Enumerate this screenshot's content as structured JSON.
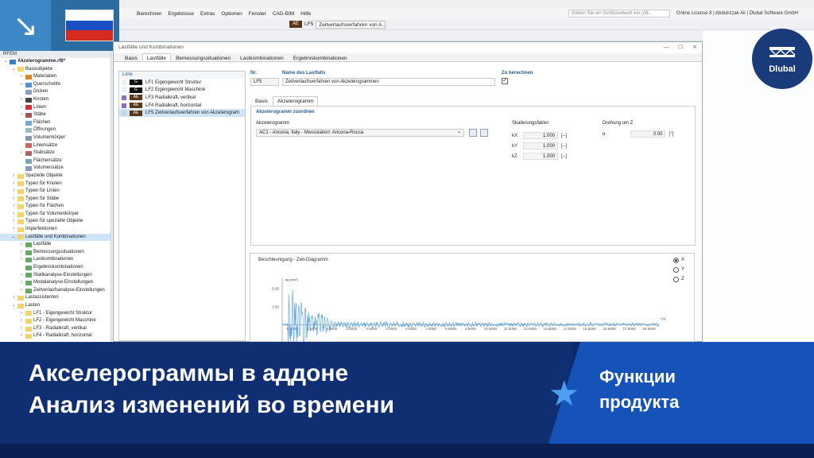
{
  "menu": {
    "items": [
      "Berechnen",
      "Ergebnisse",
      "Extras",
      "Optionen",
      "Fenster",
      "CAD-BIM",
      "Hilfe"
    ],
    "search_placeholder": "Geben Sie ein Schlüsselwort ein (Alt...",
    "license": "Online License 8 | Abdulrzzak Ali | Dlubal Software GmbH"
  },
  "toolbar": {
    "lc_tag": "AE",
    "lc_id": "LF5",
    "lc_name": "Zeitverlaufsverfahren von A..."
  },
  "navigator": {
    "header": "RFEM",
    "items": [
      {
        "label": "Akzelerogramme.rf6*",
        "lvl": 0,
        "ex": "v",
        "c": "#3a7fc1",
        "bold": true
      },
      {
        "label": "Basisobjekte",
        "lvl": 1,
        "ex": "v",
        "c": "#f3d36b"
      },
      {
        "label": "Materialien",
        "lvl": 2,
        "ex": ">",
        "c": "#d6852b"
      },
      {
        "label": "Querschnitte",
        "lvl": 2,
        "ex": ">",
        "c": "#5a8fd0"
      },
      {
        "label": "Dicken",
        "lvl": 2,
        "ex": "",
        "c": "#8aa0c0"
      },
      {
        "label": "Knoten",
        "lvl": 2,
        "ex": ">",
        "c": "#444"
      },
      {
        "label": "Linien",
        "lvl": 2,
        "ex": ">",
        "c": "#c33"
      },
      {
        "label": "Stäbe",
        "lvl": 2,
        "ex": ">",
        "c": "#a55"
      },
      {
        "label": "Flächen",
        "lvl": 2,
        "ex": "",
        "c": "#7aa7d6"
      },
      {
        "label": "Öffnungen",
        "lvl": 2,
        "ex": "",
        "c": "#9bb"
      },
      {
        "label": "Volumenkörper",
        "lvl": 2,
        "ex": "",
        "c": "#89a"
      },
      {
        "label": "Liniensätze",
        "lvl": 2,
        "ex": "",
        "c": "#c66"
      },
      {
        "label": "Stabsätze",
        "lvl": 2,
        "ex": ">",
        "c": "#a66"
      },
      {
        "label": "Flächensätze",
        "lvl": 2,
        "ex": "",
        "c": "#7aa"
      },
      {
        "label": "Volumensätze",
        "lvl": 2,
        "ex": "",
        "c": "#89b"
      },
      {
        "label": "Spezielle Objekte",
        "lvl": 1,
        "ex": ">",
        "c": "#f3d36b"
      },
      {
        "label": "Typen für Knoten",
        "lvl": 1,
        "ex": ">",
        "c": "#f3d36b"
      },
      {
        "label": "Typen für Linien",
        "lvl": 1,
        "ex": ">",
        "c": "#f3d36b"
      },
      {
        "label": "Typen für Stäbe",
        "lvl": 1,
        "ex": ">",
        "c": "#f3d36b"
      },
      {
        "label": "Typen für Flächen",
        "lvl": 1,
        "ex": ">",
        "c": "#f3d36b"
      },
      {
        "label": "Typen für Volumenkörper",
        "lvl": 1,
        "ex": ">",
        "c": "#f3d36b"
      },
      {
        "label": "Typen für spezielle Objekte",
        "lvl": 1,
        "ex": ">",
        "c": "#f3d36b"
      },
      {
        "label": "Imperfektionen",
        "lvl": 1,
        "ex": ">",
        "c": "#f3d36b"
      },
      {
        "label": "Lastfälle und Kombinationen",
        "lvl": 1,
        "ex": "v",
        "c": "#f3d36b",
        "sel": true
      },
      {
        "label": "Lastfälle",
        "lvl": 2,
        "ex": ">",
        "c": "#6a6"
      },
      {
        "label": "Bemessungssituationen",
        "lvl": 2,
        "ex": ">",
        "c": "#6a6"
      },
      {
        "label": "Lastkombinationen",
        "lvl": 2,
        "ex": ">",
        "c": "#6a6"
      },
      {
        "label": "Ergebniskombinationen",
        "lvl": 2,
        "ex": "",
        "c": "#6a6"
      },
      {
        "label": "Statikanalyse-Einstellungen",
        "lvl": 2,
        "ex": ">",
        "c": "#6a6"
      },
      {
        "label": "Modalanalyse-Einstellungen",
        "lvl": 2,
        "ex": ">",
        "c": "#6a6"
      },
      {
        "label": "Zeitverlaufsanalyse-Einstellungen",
        "lvl": 2,
        "ex": ">",
        "c": "#6a6"
      },
      {
        "label": "Lastassistenten",
        "lvl": 1,
        "ex": ">",
        "c": "#f3d36b"
      },
      {
        "label": "Lasten",
        "lvl": 1,
        "ex": "v",
        "c": "#f3d36b"
      },
      {
        "label": "LF1 - Eigengewicht Struktur",
        "lvl": 2,
        "ex": ">",
        "c": "#f3d36b"
      },
      {
        "label": "LF2 - Eigengewicht Maschine",
        "lvl": 2,
        "ex": ">",
        "c": "#f3d36b"
      },
      {
        "label": "LF3 - Radialkraft, vertikal",
        "lvl": 2,
        "ex": ">",
        "c": "#f3d36b"
      },
      {
        "label": "LF4 - Radialkraft, horizontal",
        "lvl": 2,
        "ex": ">",
        "c": "#f3d36b"
      }
    ]
  },
  "dialog": {
    "title": "Lastfälle und Kombinationen",
    "tabs": [
      "Basis",
      "Lastfälle",
      "Bemessungssituationen",
      "Lastkombinationen",
      "Ergebniskombinationen"
    ],
    "list_header": "Liste",
    "list": [
      {
        "sw": "#e8f1fa",
        "tag": "G",
        "ae": false,
        "label": "LF1  Eigengewicht Struktur"
      },
      {
        "sw": "#e8f1fa",
        "tag": "G",
        "ae": false,
        "label": "LF2  Eigengewicht Maschine"
      },
      {
        "sw": "#8a6cc9",
        "tag": "AE",
        "ae": true,
        "label": "LF3  Radialkraft, vertikal"
      },
      {
        "sw": "#8a6cc9",
        "tag": "AE",
        "ae": true,
        "label": "LF4  Radialkraft, horizontal"
      },
      {
        "sw": "#c7d4e8",
        "tag": "AE",
        "ae": true,
        "label": "LF5  Zeitverlaufsverfahren von Akzelerogram",
        "sel": true
      }
    ],
    "no_label": "Nr.",
    "no_value": "LF5",
    "name_label": "Name des Lastfalls",
    "name_value": "Zeitverlaufsverfahren von Akzelerogrammen",
    "calc_label": "Zu berechnen",
    "subtabs": [
      "Basis",
      "Akzelerogramm"
    ],
    "section": "Akzelerogramm zuordnen",
    "acc_label": "Akzelerogramm",
    "acc_value": "AC1 - Ancona, Italy - Messstation: Ancona-Rocca",
    "scale_label": "Skalierungsfaktor",
    "scale": [
      {
        "k": "kX",
        "v": "1.000",
        "u": "[--]"
      },
      {
        "k": "kY",
        "v": "1.000",
        "u": "[--]"
      },
      {
        "k": "kZ",
        "v": "1.000",
        "u": "[--]"
      }
    ],
    "rot_label": "Drehung um Z",
    "rot_sym": "α",
    "rot_value": "0.00",
    "rot_unit": "[°]",
    "radio": [
      "X",
      "Y",
      "Z"
    ]
  },
  "chart_data": {
    "type": "line",
    "title": "Beschleunigung - Zeit-Diagramm",
    "ylabel": "ag [m/s²]",
    "xlabel": "t [s]",
    "yticks": [
      "5.00",
      "2.50"
    ],
    "xticks": [
      "0.5000",
      "1.5000",
      "2.5000",
      "3.5000",
      "4.5000",
      "5.5000",
      "6.5000",
      "7.5000",
      "8.5000",
      "9.5000",
      "10.5000",
      "11.5000",
      "12.5000",
      "13.5000",
      "14.5000",
      "15.5000",
      "16.5000",
      "17.5000",
      "18.5000"
    ],
    "xlim": [
      0,
      19
    ],
    "ylim": [
      -2.5,
      6.5
    ],
    "color": "#4b9ce6"
  },
  "banner": {
    "line1": "Акселерограммы в аддоне",
    "line2": "Анализ изменений во времени",
    "feat1": "Функции",
    "feat2": "продукта",
    "brand": "Dlubal"
  }
}
